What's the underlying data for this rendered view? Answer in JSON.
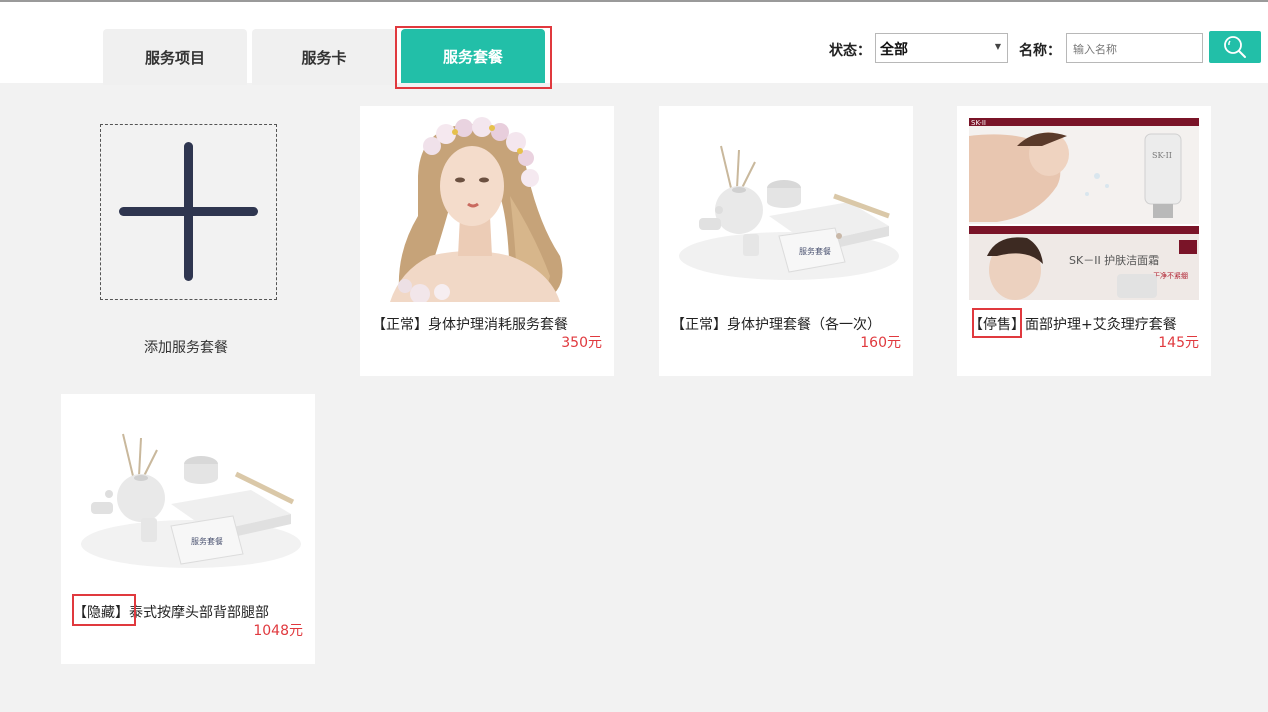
{
  "tabs": [
    {
      "label": "服务项目",
      "active": false
    },
    {
      "label": "服务卡",
      "active": false
    },
    {
      "label": "服务套餐",
      "active": true
    }
  ],
  "filters": {
    "status_label": "状态：",
    "status_value": "全部",
    "name_label": "名称：",
    "name_placeholder": "输入名称"
  },
  "add_card": {
    "label": "添加服务套餐"
  },
  "cards": [
    {
      "status": "【正常】",
      "name": "身体护理消耗服务套餐",
      "price": "350元"
    },
    {
      "status": "【正常】",
      "name": "身体护理套餐（各一次）",
      "price": "160元"
    },
    {
      "status": "【停售】",
      "name": "面部护理+艾灸理疗套餐",
      "price": "145元"
    },
    {
      "status": "【隐藏】",
      "name": "泰式按摩头部背部腿部",
      "price": "1048元"
    }
  ],
  "ad_image": {
    "brand": "SK-II",
    "headline": "SK－II 护肤洁面霜",
    "subline": "干净不紧绷"
  },
  "product_box_text": "服务套餐",
  "colors": {
    "accent": "#22bfa8",
    "highlight": "#e0393e",
    "price": "#e0393e"
  }
}
